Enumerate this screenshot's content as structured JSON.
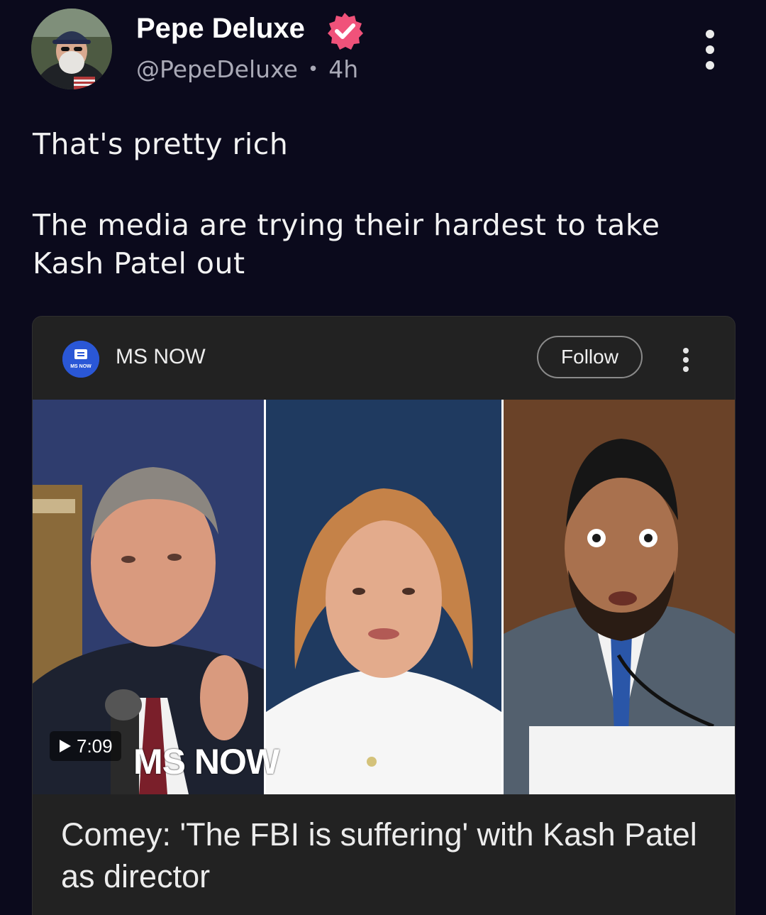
{
  "post": {
    "author": {
      "display_name": "Pepe Deluxe",
      "handle": "@PepeDeluxe",
      "separator": "•",
      "time": "4h",
      "verified": true
    },
    "text": {
      "line1": "That's pretty rich",
      "line2": "The media are trying their hardest to take Kash Patel out"
    }
  },
  "card": {
    "source": {
      "name": "MS NOW",
      "logo_text": "MS NOW"
    },
    "follow_label": "Follow",
    "video": {
      "duration": "7:09",
      "watermark": "MS NOW"
    },
    "headline": "Comey: 'The FBI is suffering' with Kash Patel as director"
  },
  "icons": {
    "more": "more-vertical-icon",
    "verified": "verified-badge-icon",
    "play": "play-icon"
  },
  "colors": {
    "background": "#0b0a1c",
    "card": "#222222",
    "verified": "#f0527a"
  }
}
